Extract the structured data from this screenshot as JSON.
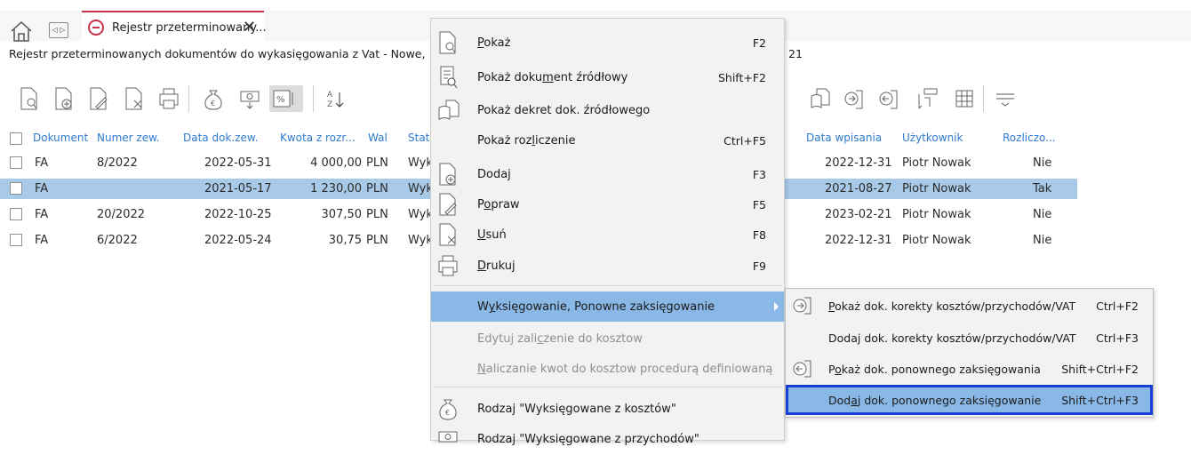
{
  "tab": {
    "title": "Rejestr przeterminowany...",
    "nav_label": "◁ ▷"
  },
  "subtitle": "Rejestr przeterminowanych dokumentów do wykasięgowania z Vat - Nowe,",
  "subtitle_tail": "21",
  "grid": {
    "columns": [
      "Dokument",
      "Numer zew.",
      "Data dok.zew.",
      "Kwota z rozr...",
      "Wal",
      "Stat",
      "Data wpisania",
      "Użytkownik",
      "Rozliczo..."
    ],
    "rows": [
      {
        "dok": "FA",
        "numer": "8/2022",
        "data": "2022-05-31",
        "kwota": "4 000,00",
        "wal": "PLN",
        "stat": "Wyk",
        "wpis": "2022-12-31",
        "user": "Piotr Nowak",
        "rozl": "Nie"
      },
      {
        "dok": "FA",
        "numer": "",
        "data": "2021-05-17",
        "kwota": "1 230,00",
        "wal": "PLN",
        "stat": "Wyk",
        "wpis": "2021-08-27",
        "user": "Piotr Nowak",
        "rozl": "Tak"
      },
      {
        "dok": "FA",
        "numer": "20/2022",
        "data": "2022-10-25",
        "kwota": "307,50",
        "wal": "PLN",
        "stat": "Wyk",
        "wpis": "2023-02-21",
        "user": "Piotr Nowak",
        "rozl": "Nie"
      },
      {
        "dok": "FA",
        "numer": "6/2022",
        "data": "2022-05-24",
        "kwota": "30,75",
        "wal": "PLN",
        "stat": "Wyk",
        "wpis": "2022-12-31",
        "user": "Piotr Nowak",
        "rozl": "Nie"
      }
    ]
  },
  "menu": {
    "pokaz": {
      "pre": "",
      "u": "P",
      "post": "okaż",
      "sc": "F2"
    },
    "pokaz_zrodlowy": {
      "pre": "Pokaż doku",
      "u": "m",
      "post": "ent źródłowy",
      "sc": "Shift+F2"
    },
    "pokaz_dekret": {
      "pre": "Pokaż dekret dok. źródłowe",
      "u": "g",
      "post": "o",
      "sc": ""
    },
    "pokaz_rozliczenie": {
      "pre": "Pokaż roz",
      "u": "l",
      "post": "iczenie",
      "sc": "Ctrl+F5"
    },
    "dodaj": {
      "pre": "Dodaj",
      "u": "",
      "post": "",
      "sc": "F3"
    },
    "popraw": {
      "pre": "P",
      "u": "o",
      "post": "praw",
      "sc": "F5"
    },
    "usun": {
      "pre": "",
      "u": "U",
      "post": "suń",
      "sc": "F8"
    },
    "drukuj": {
      "pre": "",
      "u": "D",
      "post": "rukuj",
      "sc": "F9"
    },
    "wyksiegowanie": {
      "pre": "W",
      "u": "y",
      "post": "księgowanie, Ponowne zaksięgowanie",
      "sc": ""
    },
    "edytuj": {
      "pre": "Edytuj zali",
      "u": "c",
      "post": "zenie do kosztow",
      "sc": ""
    },
    "naliczanie": {
      "pre": "",
      "u": "N",
      "post": "aliczanie kwot do kosztow procedurą definiowaną",
      "sc": ""
    },
    "rodzaj_koszty": {
      "pre": "Rodzaj \"Wyksięgowane z kosztów\"",
      "u": "",
      "post": "",
      "sc": ""
    },
    "rodzaj_przychody": {
      "pre": "Rodzaj \"Wyksięgowane z przychodów\"",
      "u": "",
      "post": "",
      "sc": ""
    }
  },
  "submenu": {
    "pokaz_korekty": {
      "pre": "",
      "u": "P",
      "post": "okaż dok. korekty kosztów/przychodów/VAT",
      "sc": "Ctrl+F2"
    },
    "dodaj_korekty": {
      "pre": "Dodaj dok. korekty kosztów/przychodów/VAT",
      "u": "",
      "post": "",
      "sc": "Ctrl+F3"
    },
    "pokaz_ponownego": {
      "pre": "P",
      "u": "o",
      "post": "każ dok. ponownego zaksięgowania",
      "sc": "Shift+Ctrl+F2"
    },
    "dodaj_ponownego": {
      "pre": "Dod",
      "u": "a",
      "post": "j dok. ponownego zaksięgowanie",
      "sc": "Shift+Ctrl+F3"
    }
  },
  "colors": {
    "accent": "#c8324a",
    "header_blue": "#2e7bd0",
    "selection": "#a9c9e8",
    "menu_highlight": "#89b7e6",
    "focus_border": "#1a3fd4"
  }
}
